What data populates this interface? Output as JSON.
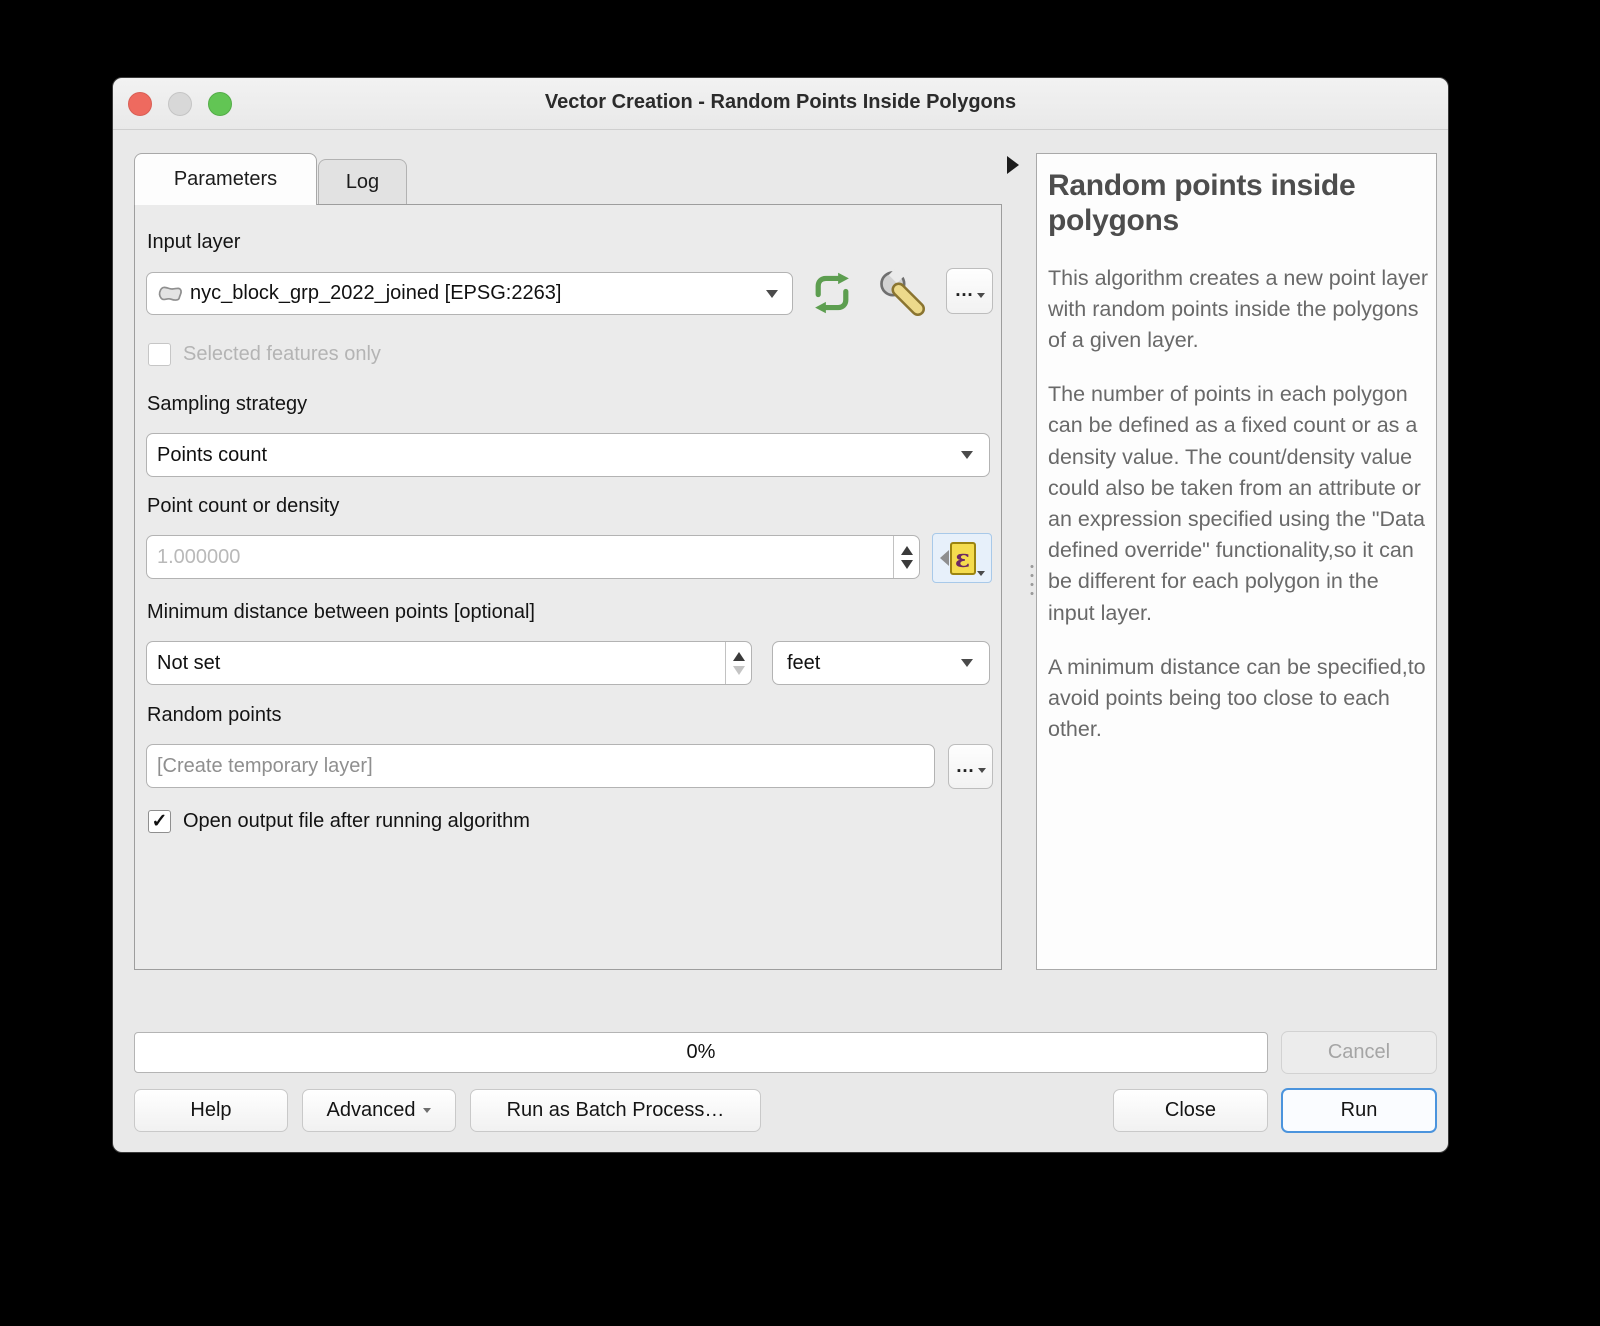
{
  "window": {
    "title": "Vector Creation - Random Points Inside Polygons"
  },
  "tabs": [
    {
      "label": "Parameters",
      "active": true
    },
    {
      "label": "Log",
      "active": false
    }
  ],
  "form": {
    "input_layer": {
      "label": "Input layer",
      "value": "nyc_block_grp_2022_joined [EPSG:2263]"
    },
    "selected_features": {
      "label": "Selected features only",
      "checked": false
    },
    "sampling_strategy": {
      "label": "Sampling strategy",
      "value": "Points count"
    },
    "point_count": {
      "label": "Point count or density",
      "value": "1.000000"
    },
    "min_distance": {
      "label": "Minimum distance between points [optional]",
      "value": "Not set",
      "unit": "feet"
    },
    "random_points": {
      "label": "Random points",
      "placeholder": "[Create temporary layer]"
    },
    "open_output": {
      "label": "Open output file after running algorithm",
      "checked": true
    }
  },
  "icons": {
    "checkmark": "✓",
    "more_label": "…",
    "epsilon": "ε",
    "polygon_layer": "polygon-layer-icon",
    "iterate": "iterate-over-layer-icon",
    "advanced_options": "wrench-icon"
  },
  "help": {
    "title": "Random points inside polygons",
    "paragraphs": [
      "This algorithm creates a new point layer with random points inside the polygons of a given layer.",
      "The number of points in each polygon can be defined as a fixed count or as a density value. The count/density value could also be taken from an attribute or an expression specified using the \"Data defined override\" functionality,so it can be different for each polygon in the input layer.",
      "A minimum distance can be specified,to avoid points being too close to each other."
    ]
  },
  "footer": {
    "progress": "0%",
    "cancel_label": "Cancel",
    "help_label": "Help",
    "advanced_label": "Advanced",
    "batch_label": "Run as Batch Process…",
    "close_label": "Close",
    "run_label": "Run"
  },
  "colors": {
    "accent_blue": "#4b94dd",
    "traffic_red": "#ee6a5f",
    "traffic_gray": "#d8d8d8",
    "traffic_green": "#62c554",
    "iterate_green": "#5d9e50",
    "ddo_yellow": "#f5dc4e",
    "ddo_purple": "#6d2862"
  }
}
